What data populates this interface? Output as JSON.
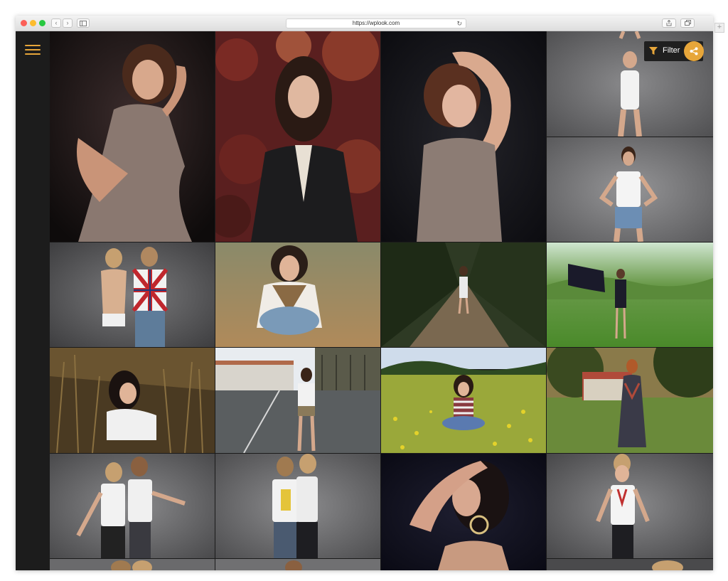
{
  "browser": {
    "url": "https://wplook.com",
    "back_glyph": "‹",
    "forward_glyph": "›",
    "reload_glyph": "↻",
    "new_tab_glyph": "+"
  },
  "toolbar": {
    "filter_label": "Filter"
  },
  "colors": {
    "accent": "#e7a63a",
    "sidebar": "#1c1c1c",
    "filter_bg": "#1f1f1f"
  },
  "icons": {
    "menu": "hamburger-menu-icon",
    "filter": "filter-funnel-icon",
    "share": "share-icon"
  },
  "gallery": {
    "photos": [
      "woman-in-mauve-dress-seated",
      "woman-in-leather-jacket-red-leaves",
      "woman-arms-raised-over-head",
      "woman-in-white-top-full-length",
      "woman-in-boss-tee-denim-skirt",
      "couple-union-jack-shirt",
      "woman-sitting-in-field",
      "woman-on-forest-path",
      "woman-with-black-flag-in-meadow",
      "woman-lying-in-tall-grass",
      "woman-on-road-by-fence",
      "woman-in-yellow-flower-field",
      "woman-in-halter-dress-garden",
      "couple-dancing-white-tees",
      "couple-white-tees-glasses",
      "woman-with-large-earrings",
      "woman-in-white-top-studio",
      "partial-photo-row-5"
    ]
  }
}
